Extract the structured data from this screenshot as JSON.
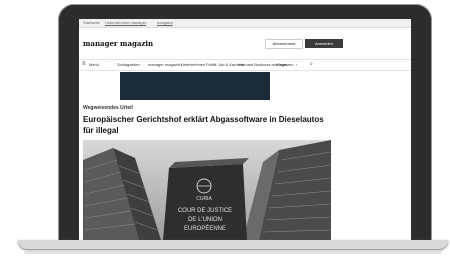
{
  "top_bar": {
    "links": [
      "Startseite",
      "Unternehmen manager",
      "Ausgabe"
    ]
  },
  "header": {
    "logo": "manager magazin",
    "abo_button": "Abonnement",
    "login_button": "Anmelden"
  },
  "nav": {
    "menu_icon": "menu-icon",
    "items": [
      "Menü",
      "Schlagzeilen",
      "manager magazin+",
      "Unternehmen",
      "Politik",
      "Job & Karriere",
      "Harvard Business manager",
      "Finanzen"
    ],
    "more_icon": "chevron-right-icon",
    "search_icon": "search-icon"
  },
  "article": {
    "kicker": "Wegweisendes Urteil",
    "headline": "Europäischer Gerichtshof erklärt Abgassoftware in Dieselautos für illegal",
    "image_sign_lines": [
      "CURIA",
      "COUR DE JUSTICE",
      "DE L'UNION",
      "EUROPÉENNE"
    ]
  },
  "colors": {
    "laptop_bezel": "#2c2c2c",
    "login_button": "#3a3a3a",
    "ad_banner": "#1a2b3a"
  }
}
